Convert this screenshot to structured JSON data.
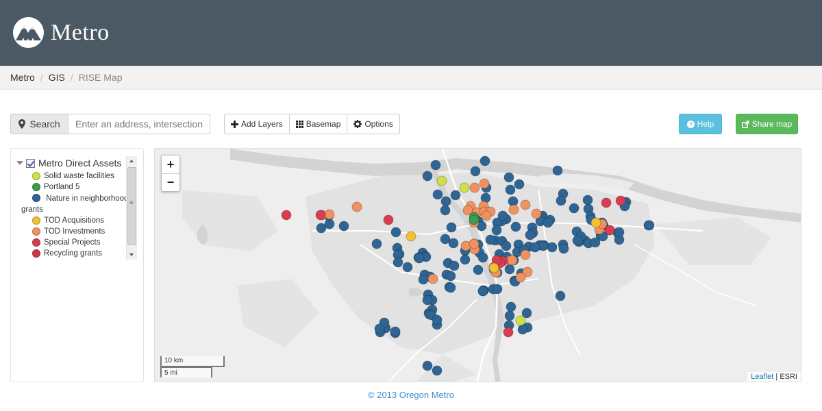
{
  "header": {
    "brand": "Metro"
  },
  "breadcrumb": [
    "Metro",
    "GIS",
    "RISE Map"
  ],
  "search": {
    "button_label": "Search",
    "placeholder": "Enter an address, intersection or"
  },
  "toolbar": {
    "add_layers": "Add Layers",
    "basemap": "Basemap",
    "options": "Options"
  },
  "help_label": "Help",
  "share_label": "Share map",
  "legend": {
    "group_title": "Metro Direct Assets",
    "group_checked": true,
    "items": [
      {
        "label": "Solid waste facilities",
        "color": "#cde04a"
      },
      {
        "label": "Portland 5",
        "color": "#3e9a4c"
      },
      {
        "label": "Nature in neighborhood grants",
        "color": "#2f6594"
      },
      {
        "label": "TOD Acquisitions",
        "color": "#f4c033"
      },
      {
        "label": "TOD Investments",
        "color": "#f0915f"
      },
      {
        "label": "Special Projects",
        "color": "#d93d52"
      },
      {
        "label": "Recycling grants",
        "color": "#c9354a"
      }
    ]
  },
  "map": {
    "zoom_in": "+",
    "zoom_out": "−",
    "scale_km": "10 km",
    "scale_mi": "5 mi",
    "attribution_link": "Leaflet",
    "attribution_sep": "|",
    "attribution_text": "ESRI",
    "point_colors": {
      "nature": "#2f6594",
      "tod_inv": "#f0915f",
      "special": "#d93d52",
      "tod_acq": "#f4c033",
      "solid": "#cde04a",
      "p5": "#3e9a4c"
    }
  },
  "footer": "© 2013 Oregon Metro"
}
